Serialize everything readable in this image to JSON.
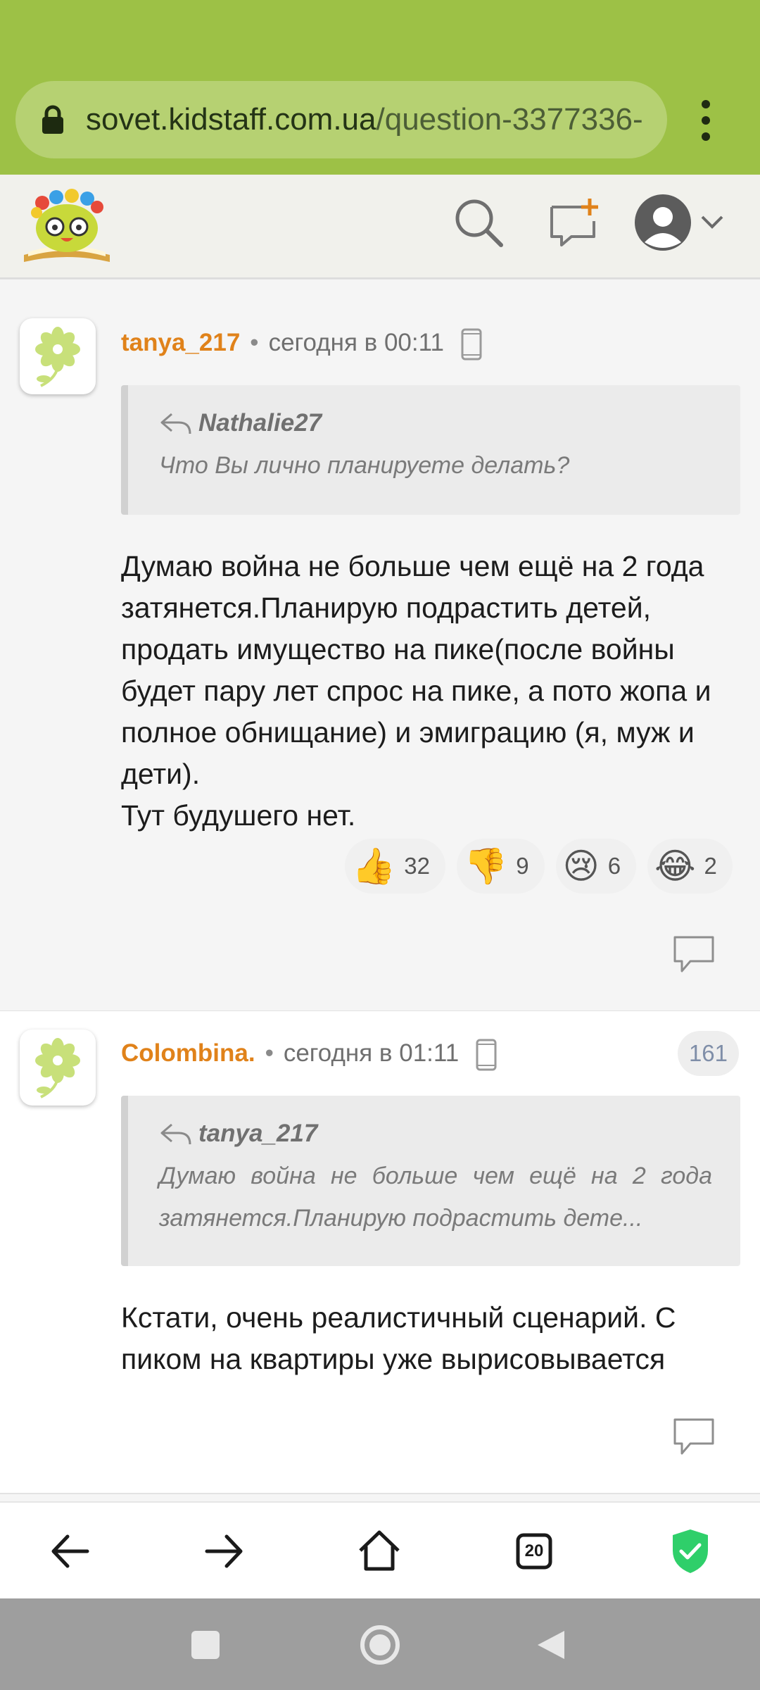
{
  "browser": {
    "url_host": "sovet.kidstaff.com.ua",
    "url_path": "/question-3377336-",
    "tabs_count": "20"
  },
  "comments": [
    {
      "author": "tanya_217",
      "time": "сегодня в 00:11",
      "quote_author": "Nathalie27",
      "quote_text": "Что Вы лично планируете делать?",
      "text": "Думаю война не больше чем ещё на 2 года затянется.Планирую подрастить детей, продать имущество на пике(после войны будет пару лет спрос на пике, а пото жопа и полное обнищание) и эмиграцию (я, муж и дети).\nТут будушего нет.",
      "reactions": [
        {
          "emoji": "👍",
          "count": "32"
        },
        {
          "emoji": "👎",
          "count": "9"
        },
        {
          "emoji": "😢",
          "count": "6"
        },
        {
          "emoji": "😂",
          "count": "2"
        }
      ]
    },
    {
      "author": "Colombina.",
      "time": "сегодня в 01:11",
      "badge": "161",
      "quote_author": "tanya_217",
      "quote_text": "Думаю война не больше чем ещё на 2 года затянется.Планирую подрастить дете...",
      "text": "Кстати, очень реалистичный сценарий. С пиком на квартиры уже вырисовывается"
    }
  ],
  "colors": {
    "browser_bar": "#9dc146",
    "author": "#e0821a",
    "shield": "#2fcf6a"
  }
}
